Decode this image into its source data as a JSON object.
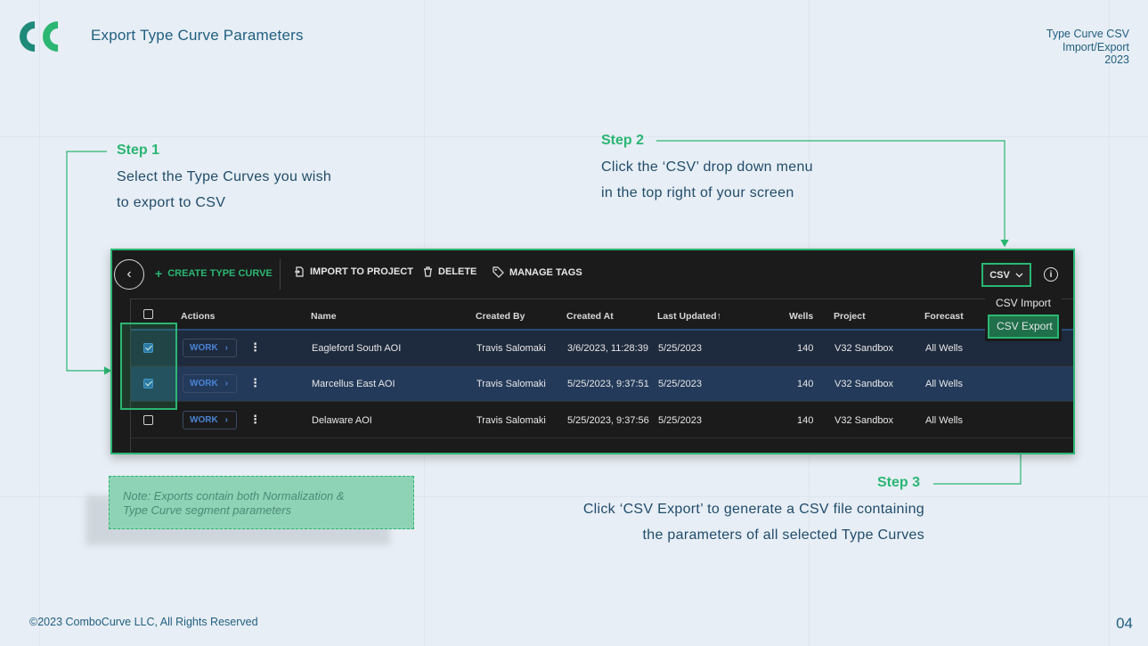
{
  "slide": {
    "title": "Export Type Curve Parameters",
    "top_right": [
      "Type Curve CSV",
      "Import/Export",
      "2023"
    ],
    "footer": "©2023 ComboCurve LLC, All Rights Reserved",
    "page_number": "04"
  },
  "steps": [
    {
      "title": "Step 1",
      "lines": [
        "Select the Type Curves you wish",
        "to export to CSV"
      ]
    },
    {
      "title": "Step 2",
      "lines": [
        "Click the ‘CSV’ drop down menu",
        "in the top right of your screen"
      ]
    },
    {
      "title": "Step 3",
      "lines": [
        "Click ‘CSV Export’ to generate a CSV file containing",
        "the parameters of all selected Type Curves"
      ]
    }
  ],
  "note": {
    "lines": [
      "Note: Exports contain both Normalization &",
      "Type Curve segment parameters"
    ]
  },
  "toolbar": {
    "create_label": "CREATE TYPE CURVE",
    "import_label": "IMPORT TO PROJECT",
    "delete_label": "DELETE",
    "tags_label": "MANAGE TAGS",
    "csv_label": "CSV"
  },
  "dropdown": {
    "import_label": "CSV Import",
    "export_label": "CSV Export"
  },
  "table": {
    "headers": [
      "Actions",
      "Name",
      "Created By",
      "Created At",
      "Last Updated",
      "Wells",
      "Project",
      "Forecast"
    ],
    "sort_indicator": "↑",
    "work_label": "WORK",
    "rows": [
      {
        "checked": true,
        "name": "Eagleford South AOI",
        "created_by": "Travis Salomaki",
        "created_at": "3/6/2023, 11:28:39",
        "last_updated": "5/25/2023",
        "wells": "140",
        "project": "V32 Sandbox",
        "forecast": "All Wells"
      },
      {
        "checked": true,
        "name": "Marcellus East AOI",
        "created_by": "Travis Salomaki",
        "created_at": "5/25/2023, 9:37:51",
        "last_updated": "5/25/2023",
        "wells": "140",
        "project": "V32 Sandbox",
        "forecast": "All Wells"
      },
      {
        "checked": false,
        "name": "Delaware AOI",
        "created_by": "Travis Salomaki",
        "created_at": "5/25/2023, 9:37:56",
        "last_updated": "5/25/2023",
        "wells": "140",
        "project": "V32 Sandbox",
        "forecast": "All Wells"
      }
    ]
  },
  "colors": {
    "accent": "#2bb673",
    "text": "#1f5f80",
    "app_bg": "#1b1b1b"
  }
}
